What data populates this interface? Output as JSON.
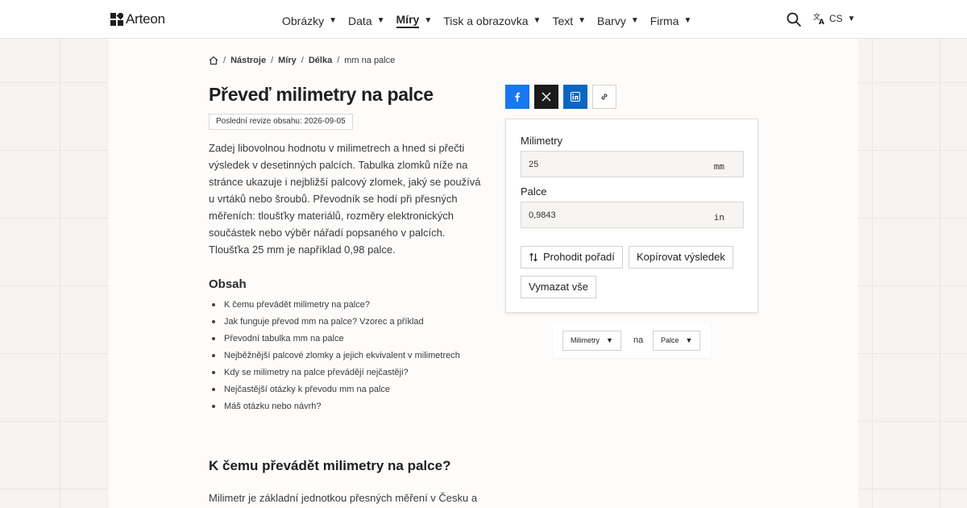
{
  "header": {
    "logo_text": "Arteon",
    "nav": [
      {
        "label": "Obrázky",
        "active": false
      },
      {
        "label": "Data",
        "active": false
      },
      {
        "label": "Míry",
        "active": true
      },
      {
        "label": "Tisk a obrazovka",
        "active": false
      },
      {
        "label": "Text",
        "active": false
      },
      {
        "label": "Barvy",
        "active": false
      },
      {
        "label": "Firma",
        "active": false
      }
    ],
    "language": "CS"
  },
  "breadcrumb": [
    "Nástroje",
    "Míry",
    "Délka"
  ],
  "breadcrumb_current": "mm na palce",
  "page": {
    "title": "Převeď milimetry na palce",
    "revision": "Poslední revize obsahu: 2026-09-05",
    "intro": [
      "Zadej libovolnou hodnotu v milimetrech a hned si přečti",
      "výsledek v desetinných palcích. Tabulka zlomků níže na",
      "stránce ukazuje i nejbližší palcový zlomek, jaký se používá",
      "u vrtáků nebo šroubů. Převodník se hodí při přesných",
      "měřeních: tloušťky materiálů, rozměry elektronických",
      "součástek nebo výběr nářadí popsaného v palcích.",
      "Tloušťka 25 mm je například 0,98 palce."
    ],
    "toc_title": "Obsah",
    "toc": [
      "K čemu převádět milimetry na palce?",
      "Jak funguje převod mm na palce? Vzorec a příklad",
      "Převodní tabulka mm na palce",
      "Nejběžnější palcové zlomky a jejich ekvivalent v milimetrech",
      "Kdy se milimetry na palce převádějí nejčastěji?",
      "Nejčastější otázky k převodu mm na palce",
      "Máš otázku nebo návrh?"
    ],
    "section_title": "K čemu převádět milimetry na palce?",
    "section_text": "Milimetr je základní jednotkou přesných měření v Česku a"
  },
  "share": [
    "facebook-icon",
    "x-icon",
    "linkedin-icon",
    "link-icon"
  ],
  "converter": {
    "from_label": "Milimetry",
    "from_value": "25",
    "from_unit": "mm",
    "to_label": "Palce",
    "to_value": "0,9843",
    "to_unit": "in",
    "swap_label": "Prohodit pořadí",
    "copy_label": "Kopírovat výsledek",
    "clear_label": "Vymazat vše"
  },
  "selector": {
    "from": "Milimetry",
    "separator": "na",
    "to": "Palce"
  },
  "colors": {
    "facebook": "#1877f2",
    "x": "#1b1b1b",
    "linkedin": "#0a66c2",
    "background": "#f6f3f1"
  }
}
